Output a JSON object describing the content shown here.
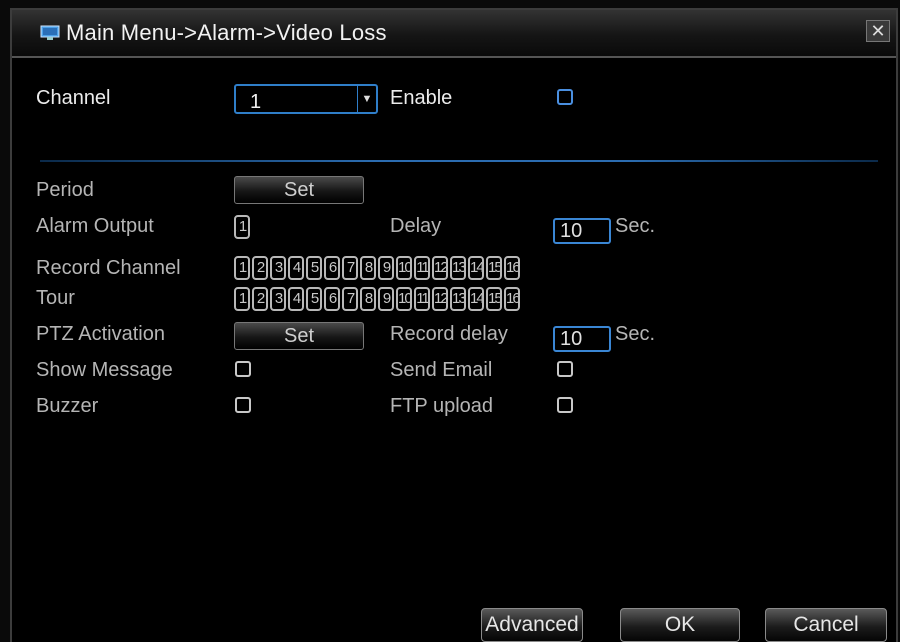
{
  "title": "Main Menu->Alarm->Video Loss",
  "close_glyph": "✕",
  "channel": {
    "label": "Channel",
    "value": "1"
  },
  "enable": {
    "label": "Enable",
    "checked": false
  },
  "period": {
    "label": "Period",
    "button": "Set"
  },
  "alarm_output": {
    "label": "Alarm Output",
    "channels": [
      "1"
    ]
  },
  "delay": {
    "label": "Delay",
    "value": "10",
    "unit": "Sec."
  },
  "record_channel": {
    "label": "Record Channel",
    "channels": [
      "1",
      "2",
      "3",
      "4",
      "5",
      "6",
      "7",
      "8",
      "9",
      "10",
      "11",
      "12",
      "13",
      "14",
      "15",
      "16"
    ]
  },
  "tour": {
    "label": "Tour",
    "channels": [
      "1",
      "2",
      "3",
      "4",
      "5",
      "6",
      "7",
      "8",
      "9",
      "10",
      "11",
      "12",
      "13",
      "14",
      "15",
      "16"
    ]
  },
  "ptz_activation": {
    "label": "PTZ Activation",
    "button": "Set"
  },
  "record_delay": {
    "label": "Record delay",
    "value": "10",
    "unit": "Sec."
  },
  "show_message": {
    "label": "Show Message",
    "checked": false
  },
  "send_email": {
    "label": "Send Email",
    "checked": false
  },
  "buzzer": {
    "label": "Buzzer",
    "checked": false
  },
  "ftp_upload": {
    "label": "FTP upload",
    "checked": false
  },
  "footer": {
    "advanced": "Advanced",
    "ok": "OK",
    "cancel": "Cancel"
  },
  "colors": {
    "accent": "#2f7ec9",
    "background": "#000000",
    "text": "#ececec",
    "dim_text": "#b5b5b5"
  }
}
